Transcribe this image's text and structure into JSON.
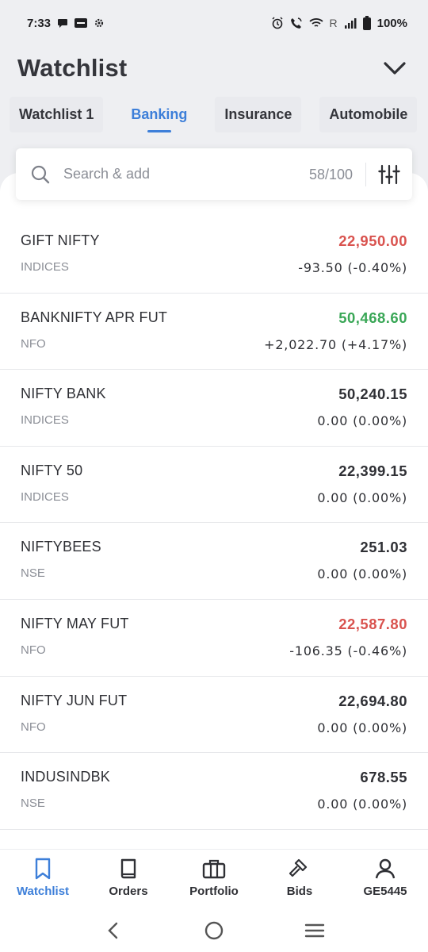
{
  "status_bar": {
    "time": "7:33",
    "network_label": "R",
    "battery": "100%",
    "icons": [
      "chat-icon",
      "paytm-icon",
      "settings-icon",
      "alarm-icon",
      "wifi-call-icon",
      "wifi-icon",
      "signal-icon",
      "battery-icon"
    ]
  },
  "header": {
    "title": "Watchlist",
    "collapse_icon": "chevron-down-icon"
  },
  "tabs": [
    {
      "label": "Watchlist 1",
      "active": false
    },
    {
      "label": "Banking",
      "active": true
    },
    {
      "label": "Insurance",
      "active": false
    },
    {
      "label": "Automobile",
      "active": false
    }
  ],
  "search": {
    "placeholder": "Search & add",
    "count": "58/100",
    "icon": "search-icon",
    "filter_icon": "filter-sliders-icon"
  },
  "colors": {
    "accent": "#3d7fd9",
    "negative": "#d9534f",
    "positive": "#3aa757",
    "neutral": "#2f3035"
  },
  "instruments": [
    {
      "name": "GIFT NIFTY",
      "exchange": "INDICES",
      "price": "22,950.00",
      "change": "-93.50 (-0.40%)",
      "trend": "negative"
    },
    {
      "name": "BANKNIFTY APR FUT",
      "exchange": "NFO",
      "price": "50,468.60",
      "change": "+2,022.70 (+4.17%)",
      "trend": "positive"
    },
    {
      "name": "NIFTY BANK",
      "exchange": "INDICES",
      "price": "50,240.15",
      "change": "0.00 (0.00%)",
      "trend": "neutral"
    },
    {
      "name": "NIFTY 50",
      "exchange": "INDICES",
      "price": "22,399.15",
      "change": "0.00 (0.00%)",
      "trend": "neutral"
    },
    {
      "name": "NIFTYBEES",
      "exchange": "NSE",
      "price": "251.03",
      "change": "0.00 (0.00%)",
      "trend": "neutral"
    },
    {
      "name": "NIFTY MAY FUT",
      "exchange": "NFO",
      "price": "22,587.80",
      "change": "-106.35 (-0.46%)",
      "trend": "negative"
    },
    {
      "name": "NIFTY JUN FUT",
      "exchange": "NFO",
      "price": "22,694.80",
      "change": "0.00 (0.00%)",
      "trend": "neutral"
    },
    {
      "name": "INDUSINDBK",
      "exchange": "NSE",
      "price": "678.55",
      "change": "0.00 (0.00%)",
      "trend": "neutral"
    }
  ],
  "bottom_nav": [
    {
      "label": "Watchlist",
      "icon": "bookmark-icon",
      "active": true
    },
    {
      "label": "Orders",
      "icon": "book-icon",
      "active": false
    },
    {
      "label": "Portfolio",
      "icon": "briefcase-icon",
      "active": false
    },
    {
      "label": "Bids",
      "icon": "gavel-icon",
      "active": false
    },
    {
      "label": "GE5445",
      "icon": "user-icon",
      "active": false
    }
  ],
  "system_nav": [
    "back-icon",
    "home-icon",
    "recents-icon"
  ]
}
